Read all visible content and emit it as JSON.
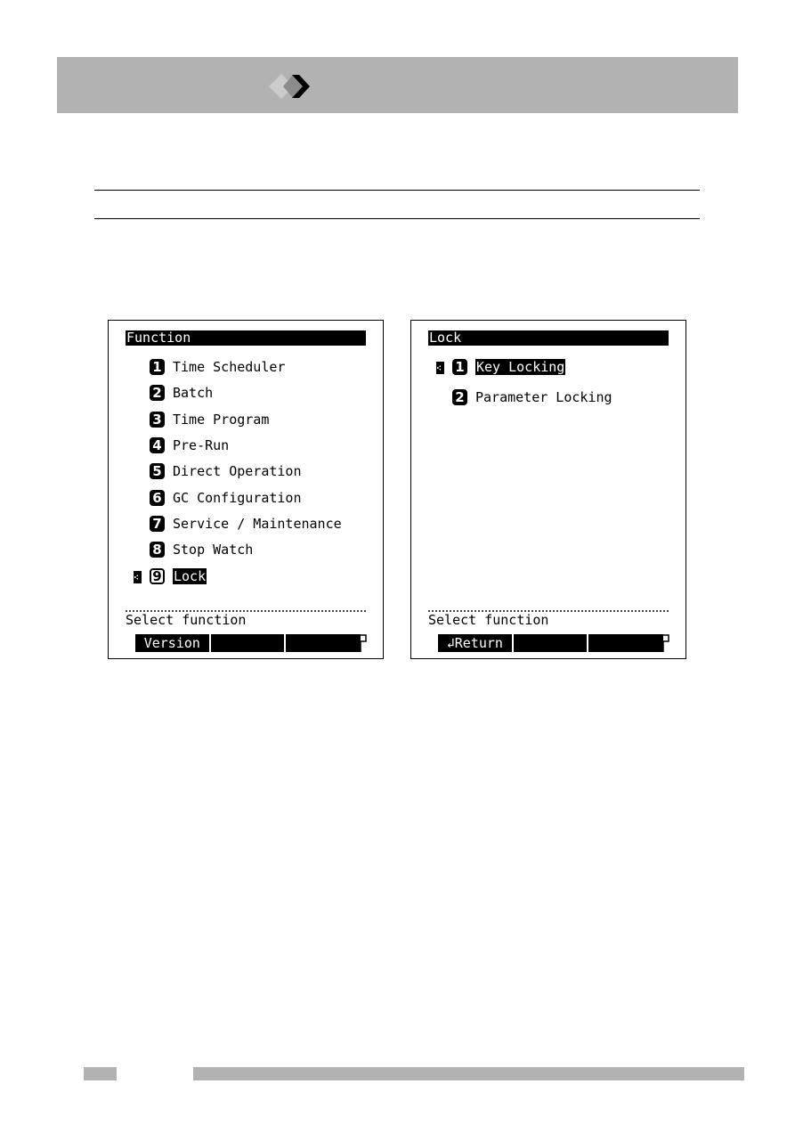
{
  "header": {
    "logo_icon": "triple-diamond-chevron-icon",
    "band_color": "#b2b2b2"
  },
  "screens": [
    {
      "title": "Function",
      "items": [
        {
          "num": "1",
          "label": "Time Scheduler",
          "selected": false
        },
        {
          "num": "2",
          "label": "Batch",
          "selected": false
        },
        {
          "num": "3",
          "label": "Time Program",
          "selected": false
        },
        {
          "num": "4",
          "label": "Pre-Run",
          "selected": false
        },
        {
          "num": "5",
          "label": "Direct Operation",
          "selected": false
        },
        {
          "num": "6",
          "label": "GC Configuration",
          "selected": false
        },
        {
          "num": "7",
          "label": "Service / Maintenance",
          "selected": false
        },
        {
          "num": "8",
          "label": "Stop Watch",
          "selected": false
        },
        {
          "num": "9",
          "label": "Lock",
          "selected": true
        }
      ],
      "status": "Select function",
      "softkeys": [
        "Version",
        "",
        ""
      ]
    },
    {
      "title": "Lock",
      "items": [
        {
          "num": "1",
          "label": "Key Locking",
          "selected": true
        },
        {
          "num": "2",
          "label": "Parameter Locking",
          "selected": false
        }
      ],
      "status": "Select function",
      "softkeys": [
        "Return",
        "",
        ""
      ],
      "softkey_icons": [
        "return-arrow-icon",
        "",
        ""
      ]
    }
  ]
}
